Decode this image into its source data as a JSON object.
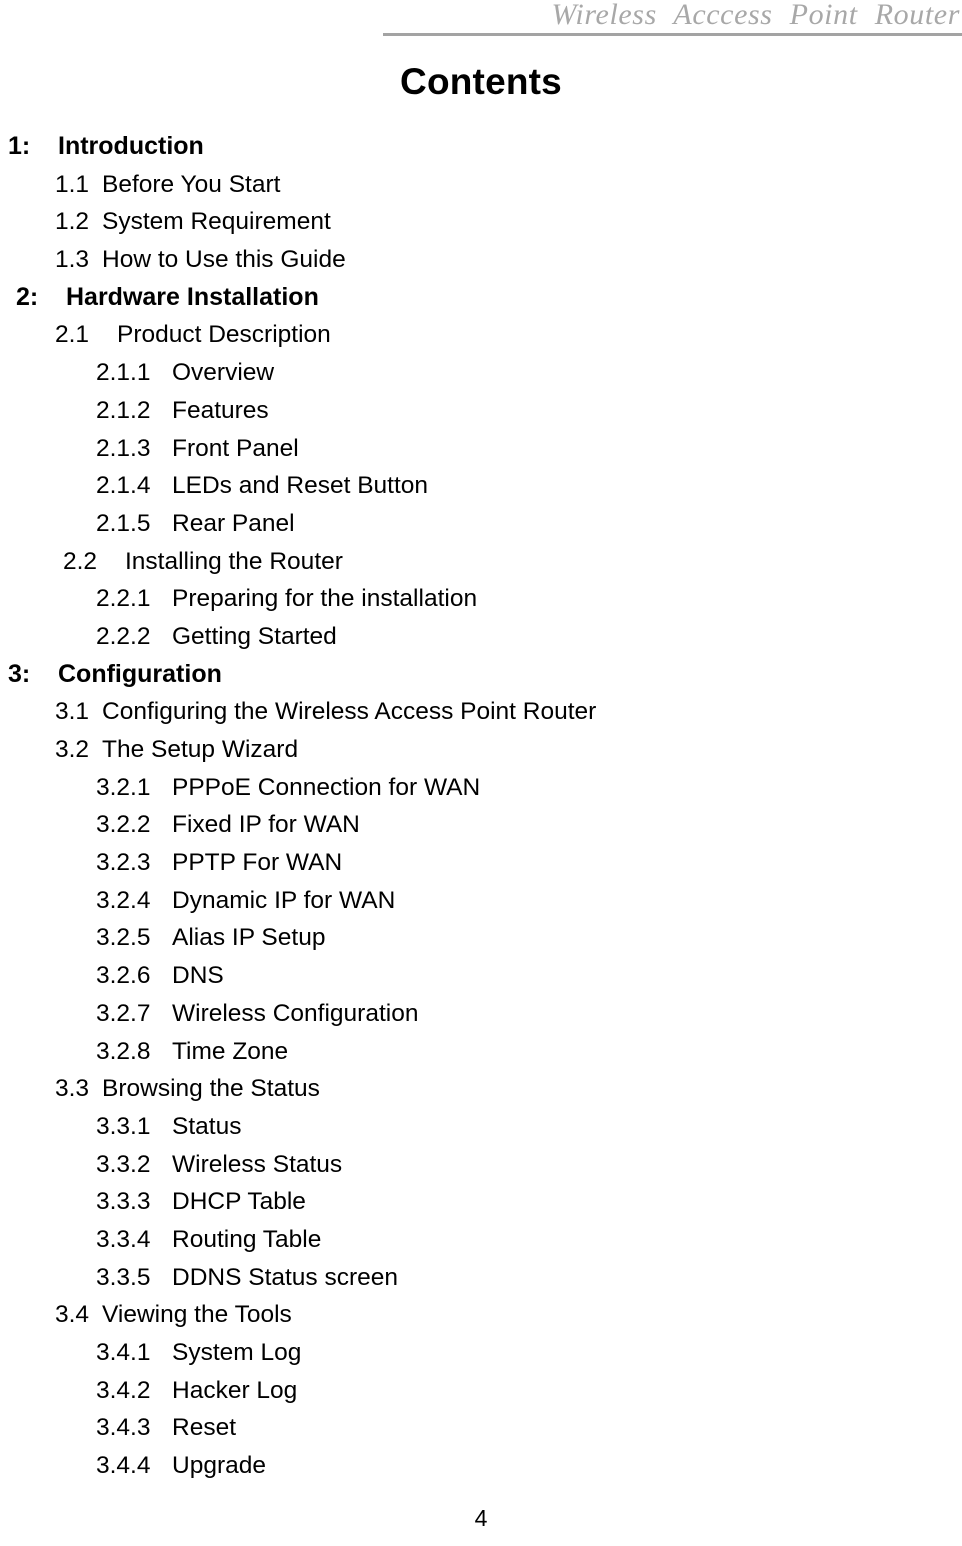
{
  "header": {
    "running_title": "Wireless Acccess Point Router"
  },
  "title": "Contents",
  "footer": {
    "page_number": "4"
  },
  "colors": {
    "header_text": "#a8a8a8",
    "header_rule": "#a3a3a3",
    "body_text": "#000000",
    "page_background": "#ffffff"
  },
  "toc": {
    "entries": [
      {
        "level": 1,
        "num": "1:",
        "label": "Introduction"
      },
      {
        "level": 2,
        "num": "1.1",
        "label": "Before You Start"
      },
      {
        "level": 2,
        "num": "1.2",
        "label": "System Requirement"
      },
      {
        "level": 2,
        "num": "1.3",
        "label": "How to Use this Guide"
      },
      {
        "level": 1,
        "num": "2:",
        "label": "Hardware Installation"
      },
      {
        "level": 2,
        "num": "2.1",
        "label": "Product Description"
      },
      {
        "level": 3,
        "num": "2.1.1",
        "label": "Overview"
      },
      {
        "level": 3,
        "num": "2.1.2",
        "label": "Features"
      },
      {
        "level": 3,
        "num": "2.1.3",
        "label": "Front Panel"
      },
      {
        "level": 3,
        "num": "2.1.4",
        "label": "LEDs and Reset Button"
      },
      {
        "level": 3,
        "num": "2.1.5",
        "label": "Rear Panel"
      },
      {
        "level": 2,
        "num": "2.2",
        "label": "Installing the Router"
      },
      {
        "level": 3,
        "num": "2.2.1",
        "label": "Preparing for the installation"
      },
      {
        "level": 3,
        "num": "2.2.2",
        "label": "Getting Started"
      },
      {
        "level": 1,
        "num": "3:",
        "label": "Configuration"
      },
      {
        "level": 2,
        "num": "3.1",
        "label": "Configuring the Wireless Access Point Router"
      },
      {
        "level": 2,
        "num": "3.2",
        "label": "The Setup Wizard"
      },
      {
        "level": 3,
        "num": "3.2.1",
        "label": "PPPoE Connection for WAN"
      },
      {
        "level": 3,
        "num": "3.2.2",
        "label": "Fixed IP for WAN"
      },
      {
        "level": 3,
        "num": "3.2.3",
        "label": "PPTP For WAN"
      },
      {
        "level": 3,
        "num": "3.2.4",
        "label": "Dynamic IP for WAN"
      },
      {
        "level": 3,
        "num": "3.2.5",
        "label": "Alias IP Setup"
      },
      {
        "level": 3,
        "num": "3.2.6",
        "label": "DNS"
      },
      {
        "level": 3,
        "num": "3.2.7",
        "label": "Wireless Configuration"
      },
      {
        "level": 3,
        "num": "3.2.8",
        "label": "Time Zone"
      },
      {
        "level": 2,
        "num": "3.3",
        "label": "Browsing the Status"
      },
      {
        "level": 3,
        "num": "3.3.1",
        "label": "Status"
      },
      {
        "level": 3,
        "num": "3.3.2",
        "label": "Wireless Status"
      },
      {
        "level": 3,
        "num": "3.3.3",
        "label": "DHCP Table"
      },
      {
        "level": 3,
        "num": "3.3.4",
        "label": "Routing Table"
      },
      {
        "level": 3,
        "num": "3.3.5",
        "label": "DDNS Status screen"
      },
      {
        "level": 2,
        "num": "3.4",
        "label": "Viewing the Tools"
      },
      {
        "level": 3,
        "num": "3.4.1",
        "label": "System Log"
      },
      {
        "level": 3,
        "num": "3.4.2",
        "label": "Hacker Log"
      },
      {
        "level": 3,
        "num": "3.4.3",
        "label": "Reset"
      },
      {
        "level": 3,
        "num": "3.4.4",
        "label": "Upgrade"
      }
    ]
  }
}
